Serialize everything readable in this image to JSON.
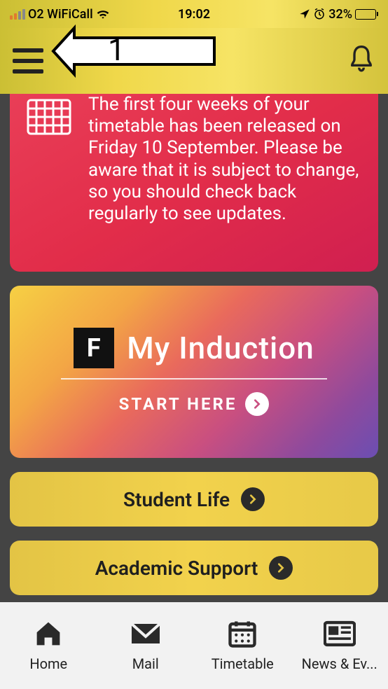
{
  "status": {
    "carrier": "O2 WiFiCall",
    "time": "19:02",
    "battery_pct": "32%"
  },
  "notice": {
    "text": "The first four weeks of your timetable has been released on Friday 10 September. Please be aware that it is subject to change, so you should check back regularly to see updates."
  },
  "induction": {
    "badge_letter": "F",
    "title": "My Induction",
    "cta": "START HERE"
  },
  "links": [
    {
      "label": "Student Life"
    },
    {
      "label": "Academic Support"
    }
  ],
  "bottom_nav": [
    {
      "label": "Home"
    },
    {
      "label": "Mail"
    },
    {
      "label": "Timetable"
    },
    {
      "label": "News & Ev..."
    }
  ],
  "annotation": {
    "number": "1"
  }
}
